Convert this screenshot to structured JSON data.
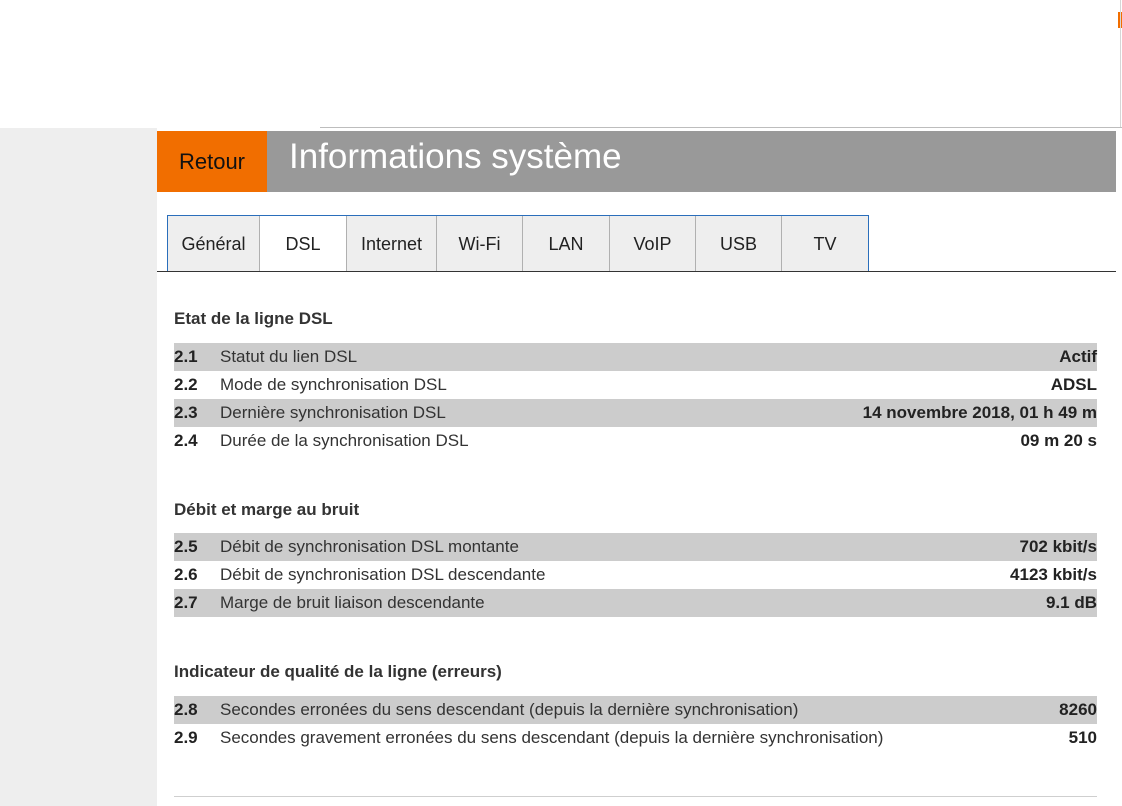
{
  "header": {
    "back_label": "Retour",
    "title": "Informations système"
  },
  "tabs": [
    "Général",
    "DSL",
    "Internet",
    "Wi-Fi",
    "LAN",
    "VoIP",
    "USB",
    "TV"
  ],
  "active_tab": "DSL",
  "colors": {
    "accent": "#f16e00",
    "header_bg": "#999999",
    "row_shade": "#cccccc",
    "tab_border": "#2a6ebb"
  },
  "sections": [
    {
      "title": "Etat de la ligne DSL",
      "rows": [
        {
          "num": "2.1",
          "label": "Statut du lien DSL",
          "value": "Actif"
        },
        {
          "num": "2.2",
          "label": "Mode de synchronisation DSL",
          "value": "ADSL"
        },
        {
          "num": "2.3",
          "label": "Dernière synchronisation DSL",
          "value": "14 novembre 2018, 01 h 49 m"
        },
        {
          "num": "2.4",
          "label": "Durée de la synchronisation DSL",
          "value": "09 m 20 s"
        }
      ]
    },
    {
      "title": "Débit et marge au bruit",
      "rows": [
        {
          "num": "2.5",
          "label": "Débit de synchronisation DSL montante",
          "value": "702 kbit/s"
        },
        {
          "num": "2.6",
          "label": "Débit de synchronisation DSL descendante",
          "value": "4123 kbit/s"
        },
        {
          "num": "2.7",
          "label": "Marge de bruit liaison descendante",
          "value": "9.1 dB"
        }
      ]
    },
    {
      "title": "Indicateur de qualité de la ligne (erreurs)",
      "rows": [
        {
          "num": "2.8",
          "label": "Secondes erronées du sens descendant (depuis la dernière synchronisation)",
          "value": "8260"
        },
        {
          "num": "2.9",
          "label": "Secondes gravement erronées du sens descendant (depuis la dernière synchronisation)",
          "value": "510"
        }
      ]
    }
  ]
}
